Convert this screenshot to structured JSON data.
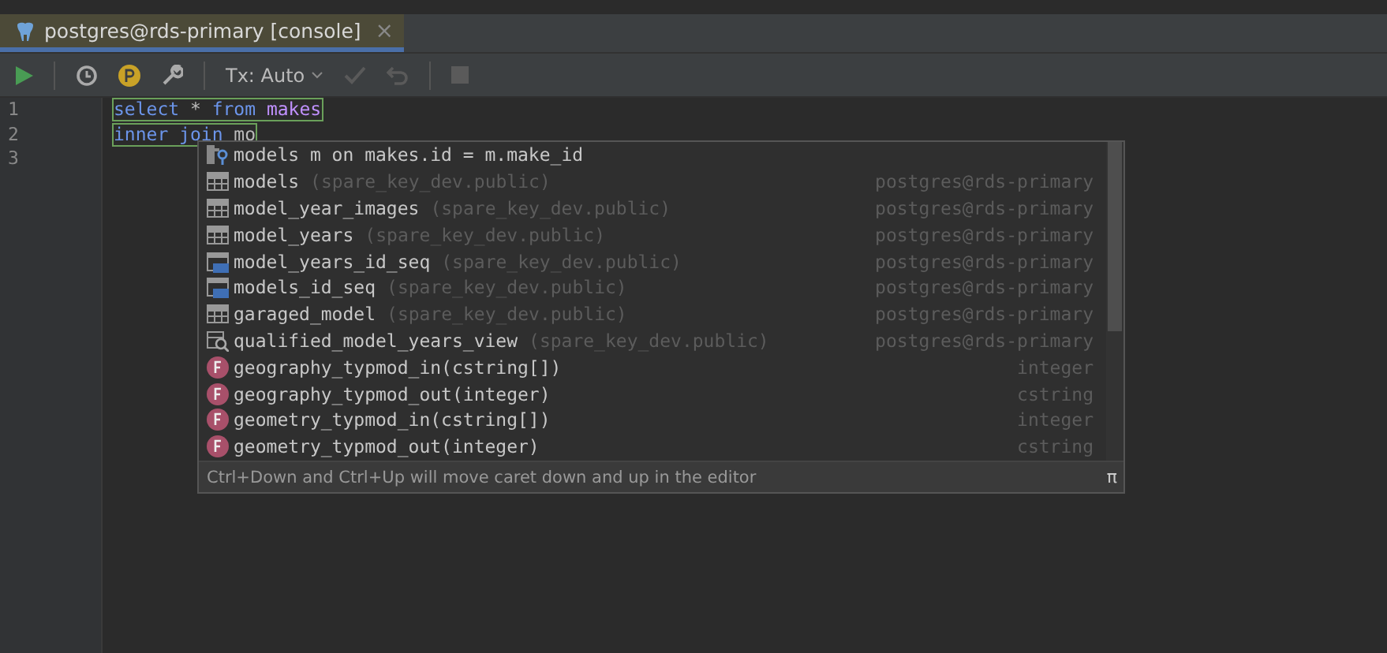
{
  "tab": {
    "title": "postgres@rds-primary [console]",
    "close": "×"
  },
  "toolbar": {
    "transaction": "Tx: Auto"
  },
  "editor": {
    "lines": [
      {
        "number": "1",
        "tokens": [
          {
            "text": "select",
            "kind": "keyword"
          },
          {
            "text": " * ",
            "kind": "plain"
          },
          {
            "text": "from",
            "kind": "keyword"
          },
          {
            "text": " makes",
            "kind": "table"
          }
        ]
      },
      {
        "number": "2",
        "tokens": [
          {
            "text": "inner",
            "kind": "keyword"
          },
          {
            "text": " join",
            "kind": "keyword"
          },
          {
            "text": " mo",
            "kind": "plain"
          }
        ]
      },
      {
        "number": "3"
      }
    ]
  },
  "completion": {
    "items": [
      {
        "kind": "join",
        "name": "models m on makes.id = m.make_id"
      },
      {
        "kind": "table",
        "name": "models",
        "schema": "(spare_key_dev.public)",
        "source": "postgres@rds-primary"
      },
      {
        "kind": "table",
        "name": "model_year_images",
        "schema": "(spare_key_dev.public)",
        "source": "postgres@rds-primary"
      },
      {
        "kind": "table",
        "name": "model_years",
        "schema": "(spare_key_dev.public)",
        "source": "postgres@rds-primary"
      },
      {
        "kind": "sequence",
        "name": "model_years_id_seq",
        "schema": "(spare_key_dev.public)",
        "source": "postgres@rds-primary"
      },
      {
        "kind": "sequence",
        "name": "models_id_seq",
        "schema": "(spare_key_dev.public)",
        "source": "postgres@rds-primary"
      },
      {
        "kind": "table",
        "name": "garaged_model",
        "schema": "(spare_key_dev.public)",
        "source": "postgres@rds-primary"
      },
      {
        "kind": "view",
        "name": "qualified_model_years_view",
        "schema": "(spare_key_dev.public)",
        "source": "postgres@rds-primary"
      },
      {
        "kind": "function",
        "name": "geography_typmod_in(cstring[])",
        "source": "integer"
      },
      {
        "kind": "function",
        "name": "geography_typmod_out(integer)",
        "source": "cstring"
      },
      {
        "kind": "function",
        "name": "geometry_typmod_in(cstring[])",
        "source": "integer"
      },
      {
        "kind": "function",
        "name": "geometry_typmod_out(integer)",
        "source": "cstring"
      }
    ],
    "hint": "Ctrl+Down and Ctrl+Up will move caret down and up in the editor",
    "pi": "π"
  }
}
